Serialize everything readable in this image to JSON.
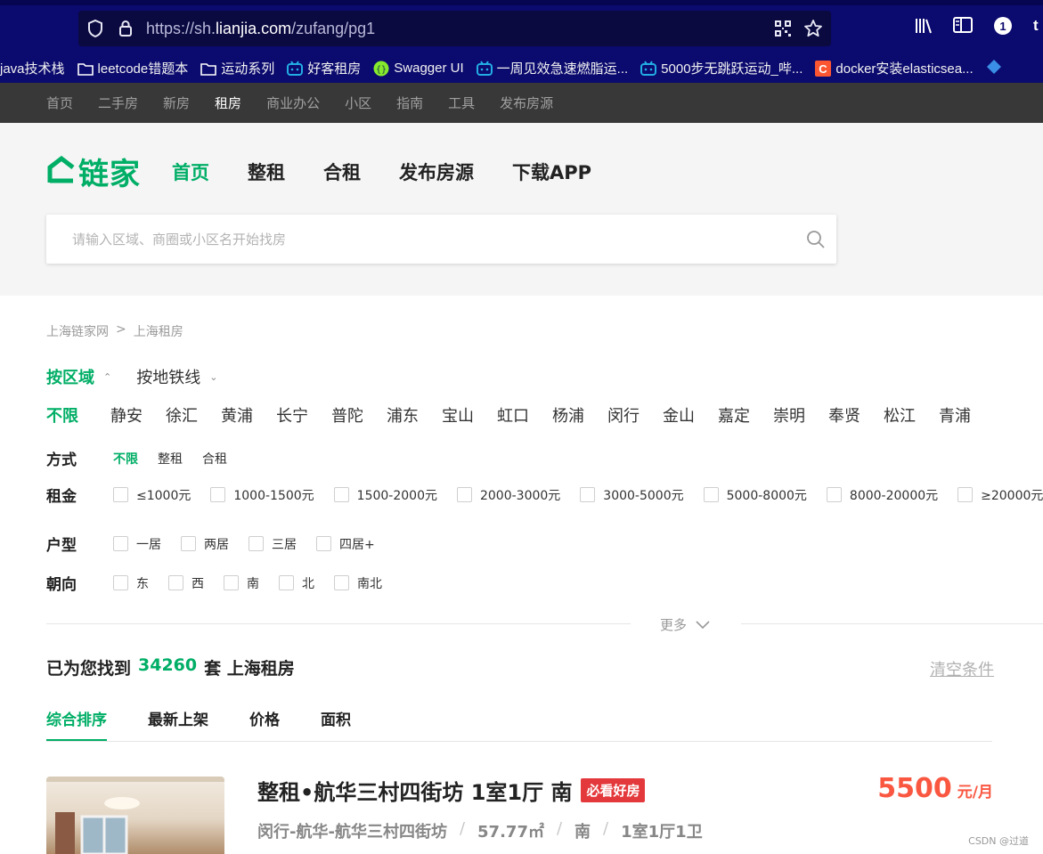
{
  "browser": {
    "url_prefix": "https://sh.",
    "url_domain": "lianjia.com",
    "url_path": "/zufang/pg1",
    "bookmarks": [
      {
        "label": "java技术栈",
        "icon": "none"
      },
      {
        "label": "leetcode错题本",
        "icon": "folder-icon"
      },
      {
        "label": "运动系列",
        "icon": "folder-icon"
      },
      {
        "label": "好客租房",
        "icon": "bilibili-icon"
      },
      {
        "label": "Swagger UI",
        "icon": "swagger-icon"
      },
      {
        "label": "一周见效急速燃脂运...",
        "icon": "bilibili-icon"
      },
      {
        "label": "5000步无跳跃运动_哔...",
        "icon": "bilibili-icon"
      },
      {
        "label": "docker安装elasticsea...",
        "icon": "csdn-icon"
      }
    ]
  },
  "sitenav": [
    "首页",
    "二手房",
    "新房",
    "租房",
    "商业办公",
    "小区",
    "指南",
    "工具",
    "发布房源"
  ],
  "sitenav_active": "租房",
  "header": {
    "logo_text": "链家",
    "mainnav": [
      "首页",
      "整租",
      "合租",
      "发布房源",
      "下载APP"
    ],
    "mainnav_active": "首页",
    "search_placeholder": "请输入区域、商圈或小区名开始找房"
  },
  "breadcrumb": [
    "上海链家网",
    ">",
    "上海租房"
  ],
  "filter_tabs": [
    "按区域",
    "按地铁线"
  ],
  "districts": [
    "不限",
    "静安",
    "徐汇",
    "黄浦",
    "长宁",
    "普陀",
    "浦东",
    "宝山",
    "虹口",
    "杨浦",
    "闵行",
    "金山",
    "嘉定",
    "崇明",
    "奉贤",
    "松江",
    "青浦"
  ],
  "filters": {
    "mode_label": "方式",
    "modes": [
      "不限",
      "整租",
      "合租"
    ],
    "rent_label": "租金",
    "rent_options": [
      "≤1000元",
      "1000-1500元",
      "1500-2000元",
      "2000-3000元",
      "3000-5000元",
      "5000-8000元",
      "8000-20000元",
      "≥20000元"
    ],
    "layout_label": "户型",
    "layout_options": [
      "一居",
      "两居",
      "三居",
      "四居+"
    ],
    "orientation_label": "朝向",
    "orientation_options": [
      "东",
      "西",
      "南",
      "北",
      "南北"
    ],
    "more_label": "更多"
  },
  "results": {
    "prefix": "已为您找到",
    "count": "34260",
    "suffix": "套 上海租房",
    "clear_label": "清空条件"
  },
  "sort_tabs": [
    "综合排序",
    "最新上架",
    "价格",
    "面积"
  ],
  "listing": {
    "title": "整租•航华三村四街坊 1室1厅 南",
    "tag": "必看好房",
    "price": "5500",
    "price_unit": "元/月",
    "location": "闵行-航华-航华三村四街坊",
    "area": "57.77㎡",
    "orientation": "南",
    "rooms": "1室1厅1卫"
  },
  "watermark": "CSDN @过道"
}
